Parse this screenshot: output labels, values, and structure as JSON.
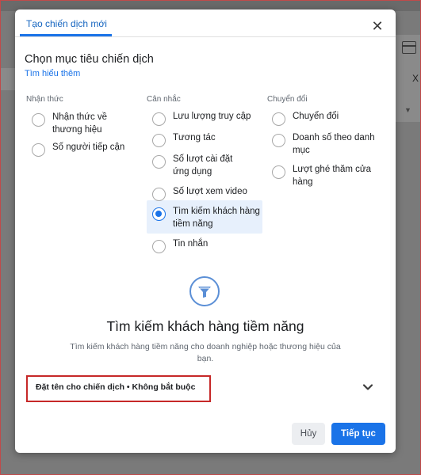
{
  "dialog": {
    "tab_label": "Tạo chiến dịch mới",
    "heading": "Chọn mục tiêu chiến dịch",
    "learn_more": "Tìm hiểu thêm",
    "close_icon": "close-icon"
  },
  "columns": [
    {
      "header": "Nhận thức",
      "options": [
        {
          "label": "Nhận thức về thương hiệu",
          "selected": false
        },
        {
          "label": "Số người tiếp cận",
          "selected": false
        }
      ]
    },
    {
      "header": "Cân nhắc",
      "options": [
        {
          "label": "Lưu lượng truy cập",
          "selected": false
        },
        {
          "label": "Tương tác",
          "selected": false
        },
        {
          "label": "Số lượt cài đặt ứng dụng",
          "selected": false
        },
        {
          "label": "Số lượt xem video",
          "selected": false
        },
        {
          "label": "Tìm kiếm khách hàng tiềm năng",
          "selected": true
        },
        {
          "label": "Tin nhắn",
          "selected": false
        }
      ]
    },
    {
      "header": "Chuyển đổi",
      "options": [
        {
          "label": "Chuyển đổi",
          "selected": false
        },
        {
          "label": "Doanh số theo danh mục",
          "selected": false
        },
        {
          "label": "Lượt ghé thăm cửa hàng",
          "selected": false
        }
      ]
    }
  ],
  "selected_objective": {
    "icon": "funnel-icon",
    "title": "Tìm kiếm khách hàng tiềm năng",
    "description": "Tìm kiếm khách hàng tiềm năng cho doanh nghiệp hoặc thương hiệu của bạn."
  },
  "campaign_name": {
    "label": "Đặt tên cho chiến dịch • Không bắt buộc"
  },
  "footer": {
    "cancel_label": "Hủy",
    "next_label": "Tiếp tục"
  },
  "colors": {
    "accent": "#1a73e8",
    "highlight_box": "#c62828",
    "selected_bg": "#e7f0fc"
  },
  "background": {
    "right_x_text": "X"
  }
}
